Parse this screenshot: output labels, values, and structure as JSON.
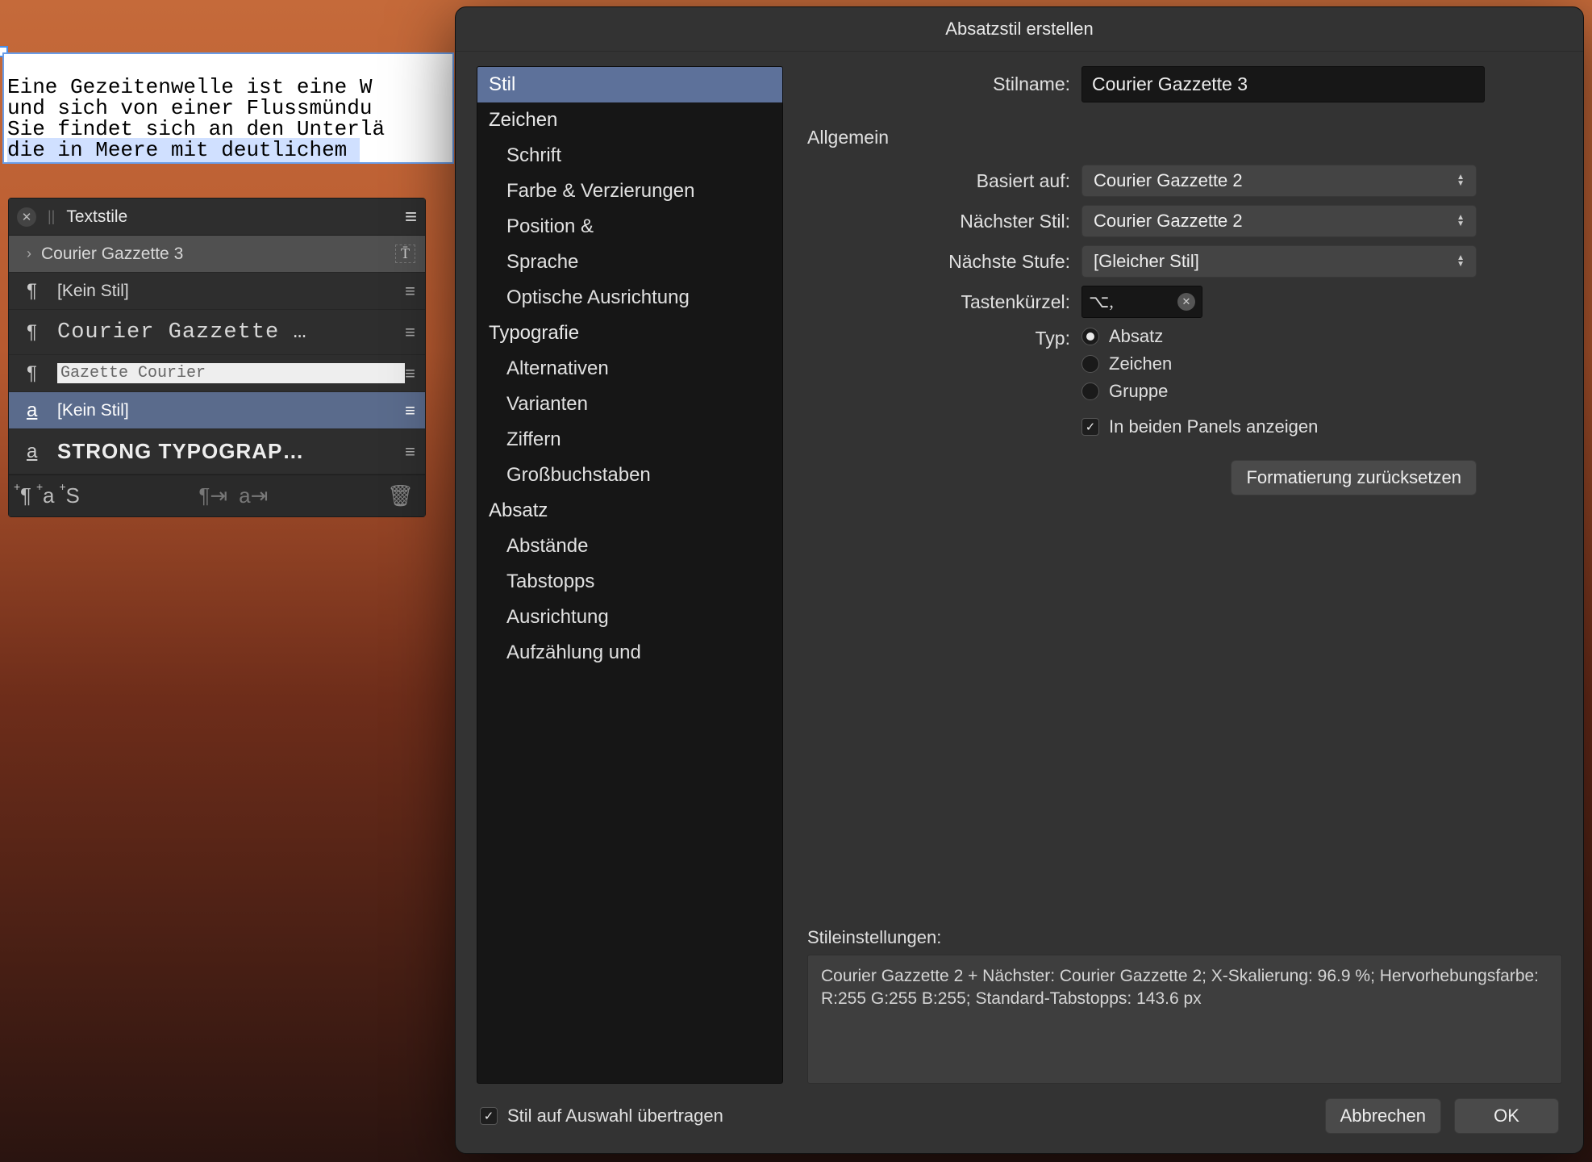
{
  "document": {
    "line1": "Eine Gezeitenwelle ist eine W",
    "line2": "und sich von einer Flussmündu",
    "line3": "Sie findet sich an den Unterlä",
    "line4": "die in Meere mit deutlichem "
  },
  "panel": {
    "title": "Textstile",
    "currentStyle": "Courier Gazzette 3",
    "rows": {
      "noStyle1": "[Kein Stil]",
      "courier": "Courier Gazzette …",
      "editing": "Gazette Courier",
      "noStyle2": "[Kein Stil]",
      "strong": "STRONG TYPOGRAP…"
    },
    "footer": {
      "btn1": "¶",
      "btn2": "a",
      "btn3": "S"
    }
  },
  "dialog": {
    "title": "Absatzstil erstellen",
    "sidebar": {
      "stil": "Stil",
      "zeichen": "Zeichen",
      "schrift": "Schrift",
      "farbe": "Farbe & Verzierungen",
      "position": "Position &",
      "sprache": "Sprache",
      "optische": "Optische Ausrichtung",
      "typografie": "Typografie",
      "alternativen": "Alternativen",
      "varianten": "Varianten",
      "ziffern": "Ziffern",
      "gross": "Großbuchstaben",
      "absatz": "Absatz",
      "abstaende": "Abstände",
      "tabstopps": "Tabstopps",
      "ausrichtung": "Ausrichtung",
      "aufzaehlung": "Aufzählung und"
    },
    "form": {
      "stilnameLabel": "Stilname:",
      "stilnameValue": "Courier Gazzette 3",
      "allgemein": "Allgemein",
      "basiertLabel": "Basiert auf:",
      "basiertValue": "Courier Gazzette 2",
      "naechsterLabel": "Nächster Stil:",
      "naechsterValue": "Courier Gazzette 2",
      "stufeLabel": "Nächste Stufe:",
      "stufeValue": "[Gleicher Stil]",
      "shortcutLabel": "Tastenkürzel:",
      "shortcutValue": "⌥,",
      "typLabel": "Typ:",
      "typAbsatz": "Absatz",
      "typZeichen": "Zeichen",
      "typGruppe": "Gruppe",
      "beidenPanels": "In beiden Panels anzeigen",
      "resetBtn": "Formatierung zurücksetzen"
    },
    "settings": {
      "label": "Stileinstellungen:",
      "text": "Courier Gazzette 2 + Nächster: Courier Gazzette 2; X-Skalierung: 96.9 %; Hervorhebungsfarbe: R:255 G:255 B:255; Standard-Tabstopps: 143.6 px"
    },
    "footer": {
      "applyLabel": "Stil auf Auswahl übertragen",
      "cancel": "Abbrechen",
      "ok": "OK"
    }
  }
}
